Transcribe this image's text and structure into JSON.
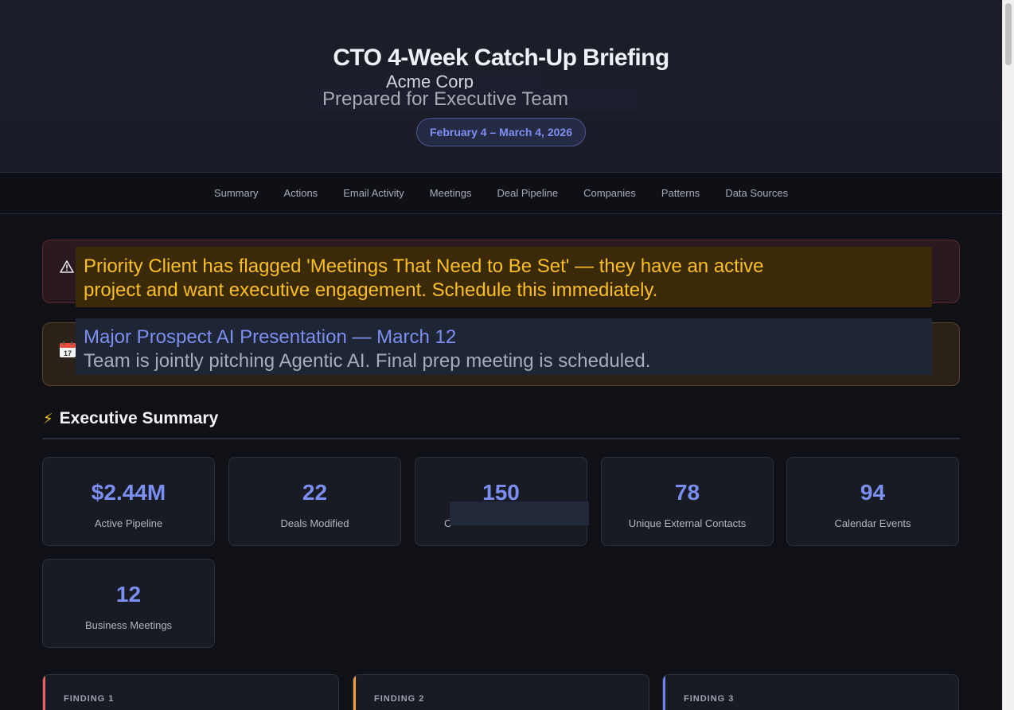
{
  "header": {
    "title": "CTO 4-Week Catch-Up Briefing",
    "company": "Acme Corp",
    "subtitle": "Prepared for Executive Team",
    "date_range": "February 4 – March 4, 2026"
  },
  "nav": {
    "items": [
      "Summary",
      "Actions",
      "Email Activity",
      "Meetings",
      "Deal Pipeline",
      "Companies",
      "Patterns",
      "Data Sources"
    ]
  },
  "alerts": {
    "priority": {
      "icon": "warning-icon",
      "line1": "Priority Client has flagged 'Meetings That Need to Be Set' — they have an active",
      "line2": "project and want executive engagement. Schedule this immediately."
    },
    "presentation": {
      "icon": "calendar-icon",
      "icon_text": "17",
      "title": "Major Prospect AI Presentation — March 12",
      "text": "Team is jointly pitching Agentic AI. Final prep meeting is scheduled."
    }
  },
  "executive_summary": {
    "icon": "lightning-icon",
    "title": "Executive Summary",
    "stats": [
      {
        "value": "$2.44M",
        "label": "Active Pipeline"
      },
      {
        "value": "22",
        "label": "Deals Modified"
      },
      {
        "value": "150",
        "label": "C"
      },
      {
        "value": "78",
        "label": "Unique External Contacts"
      },
      {
        "value": "94",
        "label": "Calendar Events"
      },
      {
        "value": "12",
        "label": "Business Meetings"
      }
    ]
  },
  "findings": [
    {
      "label": "FINDING 1",
      "color": "#ef5f5f"
    },
    {
      "label": "FINDING 2",
      "color": "#f59e3b"
    },
    {
      "label": "FINDING 3",
      "color": "#6b83f0"
    }
  ],
  "colors": {
    "accent": "#7b8ff2",
    "background": "#0f1117",
    "alert_text": "#fbbf24"
  }
}
